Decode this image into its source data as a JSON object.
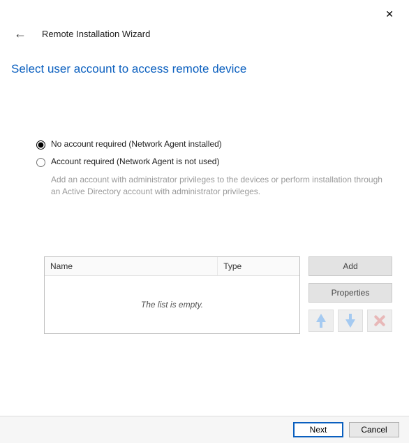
{
  "close_label": "✕",
  "back_label": "←",
  "wizard_title": "Remote Installation Wizard",
  "page_title": "Select user account to access remote device",
  "options": {
    "no_account": {
      "label": "No account required (Network Agent installed)",
      "selected": true
    },
    "account_required": {
      "label": "Account required (Network Agent is not used)",
      "selected": false,
      "helper": "Add an account with administrator privileges to the devices or perform installation through an Active Directory account with administrator privileges."
    }
  },
  "table": {
    "columns": {
      "name": "Name",
      "type": "Type"
    },
    "empty_text": "The list is empty.",
    "rows": []
  },
  "side_buttons": {
    "add": "Add",
    "properties": "Properties"
  },
  "footer": {
    "next": "Next",
    "cancel": "Cancel"
  }
}
